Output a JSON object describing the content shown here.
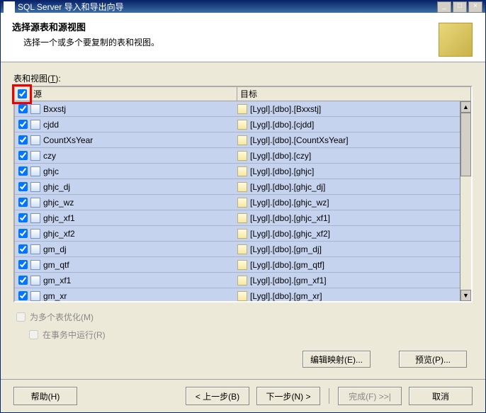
{
  "window": {
    "title": "SQL Server 导入和导出向导"
  },
  "header": {
    "title": "选择源表和源视图",
    "subtitle": "选择一个或多个要复制的表和视图。"
  },
  "list": {
    "label_prefix": "表和视图(",
    "label_accel": "T",
    "label_suffix": "):",
    "col_check": "",
    "col_source": "源",
    "col_target": "目标",
    "rows": [
      {
        "checked": true,
        "source": "Bxxstj",
        "target": "[Lygl].[dbo].[Bxxstj]"
      },
      {
        "checked": true,
        "source": "cjdd",
        "target": "[Lygl].[dbo].[cjdd]"
      },
      {
        "checked": true,
        "source": "CountXsYear",
        "target": "[Lygl].[dbo].[CountXsYear]"
      },
      {
        "checked": true,
        "source": "czy",
        "target": "[Lygl].[dbo].[czy]"
      },
      {
        "checked": true,
        "source": "ghjc",
        "target": "[Lygl].[dbo].[ghjc]"
      },
      {
        "checked": true,
        "source": "ghjc_dj",
        "target": "[Lygl].[dbo].[ghjc_dj]"
      },
      {
        "checked": true,
        "source": "ghjc_wz",
        "target": "[Lygl].[dbo].[ghjc_wz]"
      },
      {
        "checked": true,
        "source": "ghjc_xf1",
        "target": "[Lygl].[dbo].[ghjc_xf1]"
      },
      {
        "checked": true,
        "source": "ghjc_xf2",
        "target": "[Lygl].[dbo].[ghjc_xf2]"
      },
      {
        "checked": true,
        "source": "gm_dj",
        "target": "[Lygl].[dbo].[gm_dj]"
      },
      {
        "checked": true,
        "source": "gm_qtf",
        "target": "[Lygl].[dbo].[gm_qtf]"
      },
      {
        "checked": true,
        "source": "gm_xf1",
        "target": "[Lygl].[dbo].[gm_xf1]"
      },
      {
        "checked": true,
        "source": "gm_xr",
        "target": "[Lygl].[dbo].[gm_xr]"
      }
    ]
  },
  "options": {
    "optimize": "为多个表优化(M)",
    "transaction": "在事务中运行(R)"
  },
  "actions": {
    "edit_mapping": "编辑映射(E)...",
    "preview": "预览(P)..."
  },
  "nav": {
    "help": "帮助(H)",
    "back": "< 上一步(B)",
    "next": "下一步(N) >",
    "finish": "完成(F)  >>|",
    "cancel": "取消"
  }
}
